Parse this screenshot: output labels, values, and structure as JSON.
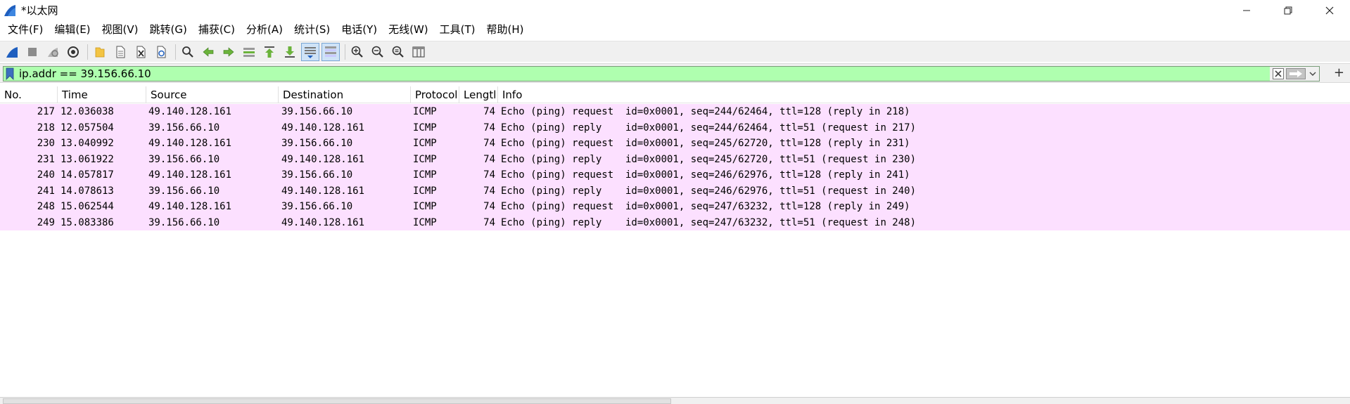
{
  "window": {
    "title": "*以太网"
  },
  "menu": [
    "文件(F)",
    "编辑(E)",
    "视图(V)",
    "跳转(G)",
    "捕获(C)",
    "分析(A)",
    "统计(S)",
    "电话(Y)",
    "无线(W)",
    "工具(T)",
    "帮助(H)"
  ],
  "filter": {
    "value": "ip.addr == 39.156.66.10",
    "add_label": "+"
  },
  "columns": [
    "No.",
    "Time",
    "Source",
    "Destination",
    "Protocol",
    "Lengtl",
    "Info"
  ],
  "packets": [
    {
      "no": "217",
      "time": "12.036038",
      "src": "49.140.128.161",
      "dst": "39.156.66.10",
      "proto": "ICMP",
      "len": "74",
      "info": "Echo (ping) request  id=0x0001, seq=244/62464, ttl=128 (reply in 218)"
    },
    {
      "no": "218",
      "time": "12.057504",
      "src": "39.156.66.10",
      "dst": "49.140.128.161",
      "proto": "ICMP",
      "len": "74",
      "info": "Echo (ping) reply    id=0x0001, seq=244/62464, ttl=51 (request in 217)"
    },
    {
      "no": "230",
      "time": "13.040992",
      "src": "49.140.128.161",
      "dst": "39.156.66.10",
      "proto": "ICMP",
      "len": "74",
      "info": "Echo (ping) request  id=0x0001, seq=245/62720, ttl=128 (reply in 231)"
    },
    {
      "no": "231",
      "time": "13.061922",
      "src": "39.156.66.10",
      "dst": "49.140.128.161",
      "proto": "ICMP",
      "len": "74",
      "info": "Echo (ping) reply    id=0x0001, seq=245/62720, ttl=51 (request in 230)"
    },
    {
      "no": "240",
      "time": "14.057817",
      "src": "49.140.128.161",
      "dst": "39.156.66.10",
      "proto": "ICMP",
      "len": "74",
      "info": "Echo (ping) request  id=0x0001, seq=246/62976, ttl=128 (reply in 241)"
    },
    {
      "no": "241",
      "time": "14.078613",
      "src": "39.156.66.10",
      "dst": "49.140.128.161",
      "proto": "ICMP",
      "len": "74",
      "info": "Echo (ping) reply    id=0x0001, seq=246/62976, ttl=51 (request in 240)"
    },
    {
      "no": "248",
      "time": "15.062544",
      "src": "49.140.128.161",
      "dst": "39.156.66.10",
      "proto": "ICMP",
      "len": "74",
      "info": "Echo (ping) request  id=0x0001, seq=247/63232, ttl=128 (reply in 249)"
    },
    {
      "no": "249",
      "time": "15.083386",
      "src": "39.156.66.10",
      "dst": "49.140.128.161",
      "proto": "ICMP",
      "len": "74",
      "info": "Echo (ping) reply    id=0x0001, seq=247/63232, ttl=51 (request in 248)"
    }
  ],
  "colors": {
    "filter_valid": "#afffaf",
    "icmp_row": "#fce0ff",
    "accent": "#1f5fbf"
  }
}
